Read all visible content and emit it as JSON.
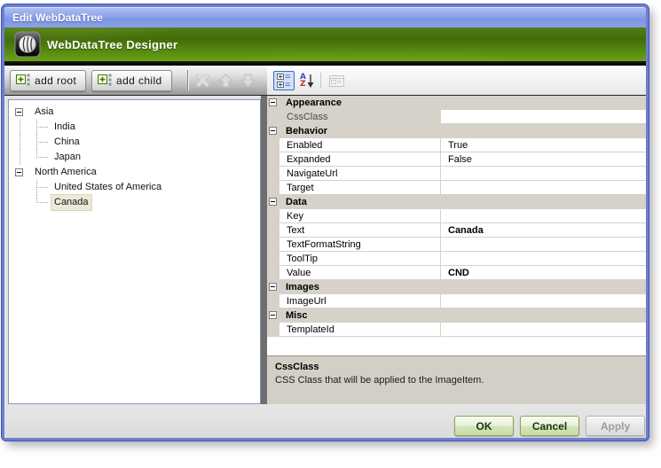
{
  "window": {
    "title": "Edit WebDataTree"
  },
  "banner": {
    "title": "WebDataTree Designer",
    "icon": "webdatatree-globe-icon"
  },
  "toolbar": {
    "add_root_label": "add root",
    "add_child_label": "add child",
    "icons": {
      "add_node": "plus-box-with-tree-icon",
      "delete": "x-delete-icon",
      "move_up": "arrow-up-icon",
      "move_down": "arrow-down-icon"
    }
  },
  "grid_toolbar": {
    "icons": {
      "categorized": "categorized-view-icon",
      "alphabetical": "a-z-sort-icon",
      "property_pages": "property-pages-icon"
    },
    "categorized_selected": true,
    "property_pages_disabled": true
  },
  "tree": {
    "items": [
      {
        "label": "Asia",
        "level": 0,
        "expanded": true
      },
      {
        "label": "India",
        "level": 1
      },
      {
        "label": "China",
        "level": 1
      },
      {
        "label": "Japan",
        "level": 1
      },
      {
        "label": "North America",
        "level": 0,
        "expanded": true
      },
      {
        "label": "United States of America",
        "level": 1
      },
      {
        "label": "Canada",
        "level": 1,
        "selected": true
      }
    ]
  },
  "property_grid": {
    "rows": [
      {
        "type": "category",
        "label": "Appearance"
      },
      {
        "type": "property",
        "name": "CssClass",
        "value": "",
        "selected": true
      },
      {
        "type": "category",
        "label": "Behavior"
      },
      {
        "type": "property",
        "name": "Enabled",
        "value": "True"
      },
      {
        "type": "property",
        "name": "Expanded",
        "value": "False"
      },
      {
        "type": "property",
        "name": "NavigateUrl",
        "value": ""
      },
      {
        "type": "property",
        "name": "Target",
        "value": ""
      },
      {
        "type": "category",
        "label": "Data"
      },
      {
        "type": "property",
        "name": "Key",
        "value": ""
      },
      {
        "type": "property",
        "name": "Text",
        "value": "Canada",
        "bold": true
      },
      {
        "type": "property",
        "name": "TextFormatString",
        "value": ""
      },
      {
        "type": "property",
        "name": "ToolTip",
        "value": ""
      },
      {
        "type": "property",
        "name": "Value",
        "value": "CND",
        "bold": true
      },
      {
        "type": "category",
        "label": "Images"
      },
      {
        "type": "property",
        "name": "ImageUrl",
        "value": ""
      },
      {
        "type": "category",
        "label": "Misc"
      },
      {
        "type": "property",
        "name": "TemplateId",
        "value": ""
      }
    ]
  },
  "description": {
    "title": "CssClass",
    "text": "CSS Class that will be applied to the ImageItem."
  },
  "footer": {
    "ok": "OK",
    "cancel": "Cancel",
    "apply": "Apply"
  },
  "colors": {
    "titlebar_blue": "#8da3e8",
    "window_border": "#6b7ed6",
    "banner_green_top": "#436c09",
    "banner_green_bottom": "#6aa216",
    "category_row_bg": "#d6d2c9",
    "tree_selection_bg": "#ece9d8",
    "green_button_bg": "#d4e4b8",
    "toolbar_dark_gray": "#999999"
  }
}
